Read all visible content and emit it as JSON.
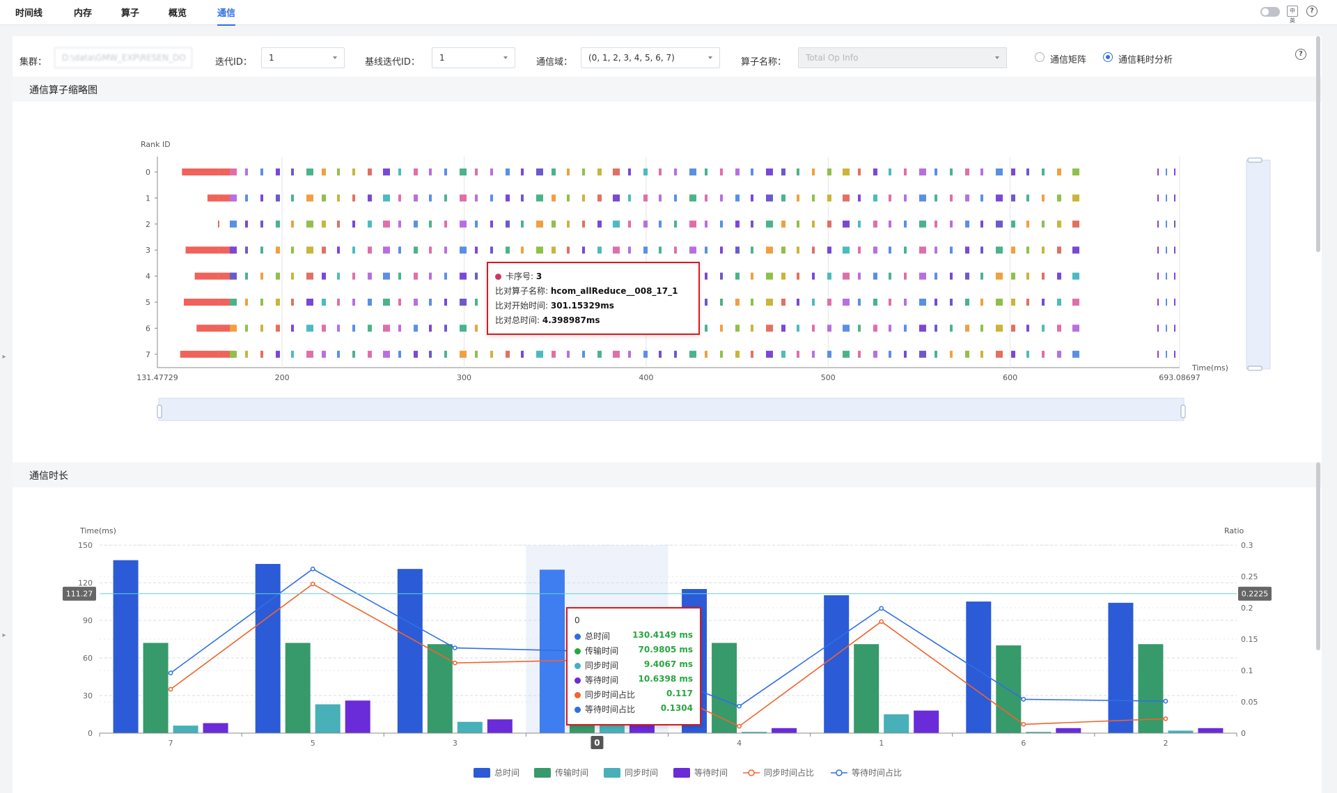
{
  "tabs": [
    {
      "label": "时间线"
    },
    {
      "label": "内存"
    },
    {
      "label": "算子"
    },
    {
      "label": "概览"
    },
    {
      "label": "通信",
      "active": true
    }
  ],
  "top_icons": {
    "toggle": "toggle-switch",
    "lang": "language-icon",
    "lang_text": "中英",
    "help": "help-icon"
  },
  "filters": {
    "cluster_label": "集群：",
    "cluster_value": "D:\\data\\GMW_EXP\\RESEN_DO",
    "iteration_label": "迭代ID：",
    "iteration_value": "1",
    "baseline_label": "基线迭代ID：",
    "baseline_value": "1",
    "domain_label": "通信域：",
    "domain_value": "(0, 1, 2, 3, 4, 5, 6, 7)",
    "op_label": "算子名称：",
    "op_placeholder": "Total Op Info",
    "radio_matrix": "通信矩阵",
    "radio_analysis": "通信耗时分析",
    "help": "?"
  },
  "section1": {
    "title": "通信算子缩略图"
  },
  "section2": {
    "title": "通信时长"
  },
  "timeline_chart": {
    "y_title": "Rank ID",
    "x_title": "Time(ms)",
    "ranks": [
      "0",
      "1",
      "2",
      "3",
      "4",
      "5",
      "6",
      "7"
    ],
    "x_min": 131.47729,
    "x_max": 693.08697,
    "x_min_label": "131.47729",
    "x_max_label": "693.08697",
    "ticks": [
      "200",
      "300",
      "400",
      "500",
      "600"
    ],
    "tick_values": [
      200,
      300,
      400,
      500,
      600
    ],
    "red_bars": [
      {
        "rank": 0,
        "start": 145.0,
        "end": 173.5
      },
      {
        "rank": 1,
        "start": 159.0,
        "end": 173.5
      },
      {
        "rank": 3,
        "start": 147.0,
        "end": 173.5
      },
      {
        "rank": 4,
        "start": 152.0,
        "end": 173.5
      },
      {
        "rank": 5,
        "start": 146.0,
        "end": 173.5
      },
      {
        "rank": 6,
        "start": 153.0,
        "end": 173.5
      },
      {
        "rank": 7,
        "start": 144.0,
        "end": 173.5
      }
    ],
    "tooltip": {
      "rank_label": "卡序号:",
      "rank_value": "3",
      "name_label": "比对算子名称:",
      "name_value": "hcom_allReduce__008_17_1",
      "start_label": "比对开始时间:",
      "start_value": "301.15329ms",
      "total_label": "比对总时间:",
      "total_value": "4.398987ms",
      "dot_color": "#c73a63"
    }
  },
  "chart_data": {
    "type": "bar",
    "categories": [
      "7",
      "5",
      "3",
      "0",
      "4",
      "1",
      "6",
      "2"
    ],
    "ylabel": "Time(ms)",
    "y2label": "Ratio",
    "ylim": [
      0,
      150
    ],
    "y2lim": [
      0,
      0.3
    ],
    "yticks": [
      "0",
      "30",
      "60",
      "90",
      "120",
      "150"
    ],
    "y2ticks": [
      "0",
      "0.05",
      "0.1",
      "0.15",
      "0.2",
      "0.25",
      "0.3"
    ],
    "highlight_category": "0",
    "crosshair_left": "111.27",
    "crosshair_right": "0.2225",
    "series": [
      {
        "name": "总时间",
        "type": "bar",
        "color": "#2b5bd7",
        "values": [
          138,
          135,
          131,
          130.4149,
          115,
          110,
          105,
          104
        ]
      },
      {
        "name": "传输时间",
        "type": "bar",
        "color": "#379a6a",
        "values": [
          72,
          72,
          71,
          70.9805,
          72,
          71,
          70,
          71
        ]
      },
      {
        "name": "同步时间",
        "type": "bar",
        "color": "#47b0b8",
        "values": [
          6,
          23,
          9,
          9.4067,
          1,
          15,
          1,
          2
        ]
      },
      {
        "name": "等待时间",
        "type": "bar",
        "color": "#6a2bd8",
        "values": [
          8,
          26,
          11,
          10.6398,
          4,
          18,
          4,
          4
        ]
      },
      {
        "name": "同步时间占比",
        "type": "line",
        "color": "#f0642d",
        "values": [
          0.07,
          0.238,
          0.112,
          0.117,
          0.011,
          0.178,
          0.014,
          0.023
        ]
      },
      {
        "name": "等待时间占比",
        "type": "line",
        "color": "#2f6fe4",
        "values": [
          0.096,
          0.262,
          0.136,
          0.1304,
          0.043,
          0.199,
          0.054,
          0.051
        ]
      }
    ],
    "tooltip": {
      "category": "0",
      "rows": [
        {
          "label": "总时间",
          "value": "130.4149 ms",
          "color": "#2f6fe4"
        },
        {
          "label": "传输时间",
          "value": "70.9805 ms",
          "color": "#2aa640"
        },
        {
          "label": "同步时间",
          "value": "9.4067 ms",
          "color": "#47b0b8"
        },
        {
          "label": "等待时间",
          "value": "10.6398 ms",
          "color": "#6a2bd8"
        },
        {
          "label": "同步时间占比",
          "value": "0.117",
          "color": "#f0642d"
        },
        {
          "label": "等待时间占比",
          "value": "0.1304",
          "color": "#2f6fe4"
        }
      ]
    }
  }
}
